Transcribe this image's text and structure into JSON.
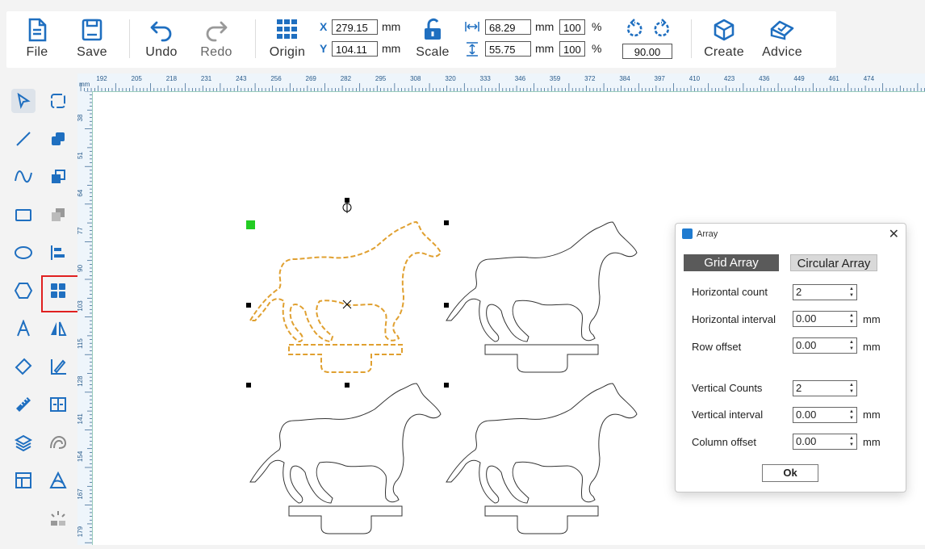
{
  "toolbar": {
    "file": "File",
    "save": "Save",
    "undo": "Undo",
    "redo": "Redo",
    "origin": "Origin",
    "scale": "Scale",
    "create": "Create",
    "advice": "Advice",
    "x_label": "X",
    "y_label": "Y",
    "x_value": "279.15",
    "y_value": "104.11",
    "unit": "mm",
    "width_value": "68.29",
    "height_value": "55.75",
    "width_pct": "100",
    "height_pct": "100",
    "pct_unit": "%",
    "rotation": "90.00"
  },
  "ruler": {
    "top_unit": "mm",
    "top_ticks": [
      "192",
      "205",
      "218",
      "231",
      "243",
      "256",
      "269",
      "282",
      "295",
      "308",
      "320",
      "333",
      "346",
      "359",
      "372",
      "384",
      "397",
      "410",
      "423",
      "436",
      "449",
      "461",
      "474"
    ],
    "left_ticks": [
      "38",
      "51",
      "64",
      "77",
      "90",
      "103",
      "115",
      "128",
      "141",
      "154",
      "167",
      "179"
    ]
  },
  "sidebar": {
    "tools": [
      "select-icon",
      "node-edit-icon",
      "line-icon",
      "combine-icon",
      "curve-icon",
      "boolean-icon",
      "rectangle-icon",
      "group-icon",
      "ellipse-icon",
      "align-icon",
      "polygon-icon",
      "array-icon",
      "text-icon",
      "mirror-icon",
      "eraser-icon",
      "edit-path-icon",
      "measure-icon",
      "distribute-icon",
      "layers-icon",
      "offset-icon",
      "template-icon",
      "vectorize-icon",
      "laser-icon"
    ]
  },
  "dialog": {
    "title": "Array",
    "close": "✕",
    "tab_grid": "Grid Array",
    "tab_circular": "Circular Array",
    "horizontal_count_label": "Horizontal count",
    "horizontal_count": "2",
    "horizontal_interval_label": "Horizontal interval",
    "horizontal_interval": "0.00",
    "row_offset_label": "Row offset",
    "row_offset": "0.00",
    "vertical_counts_label": "Vertical Counts",
    "vertical_counts": "2",
    "vertical_interval_label": "Vertical interval",
    "vertical_interval": "0.00",
    "column_offset_label": "Column offset",
    "column_offset": "0.00",
    "unit": "mm",
    "ok": "Ok"
  },
  "colors": {
    "accent": "#1f6fc0",
    "selected_outline": "#e0a030",
    "highlight": "#e02020",
    "anchor": "#22cc22"
  }
}
